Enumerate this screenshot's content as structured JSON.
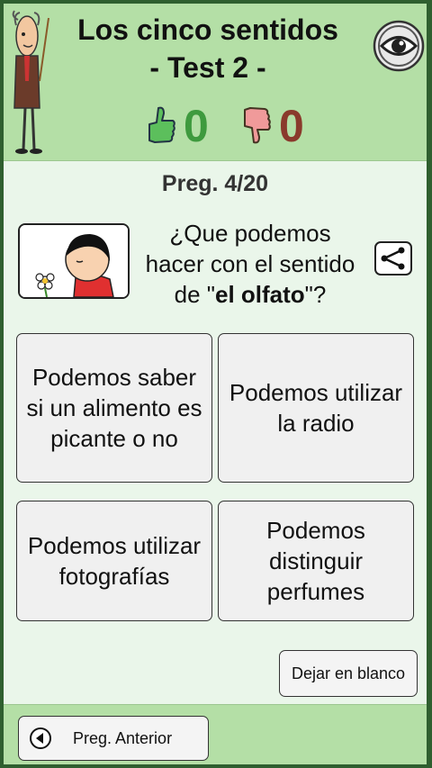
{
  "header": {
    "title_line1": "Los cinco sentidos",
    "title_line2": "- Test 2 -",
    "correct_count": "0",
    "wrong_count": "0",
    "correct_color": "#3e9a3e",
    "wrong_color": "#8a3a2c"
  },
  "question": {
    "counter": "Preg. 4/20",
    "line1": "¿Que podemos",
    "line2": "hacer con el sentido",
    "line3_pre": "de \"",
    "line3_bold": "el olfato",
    "line3_post": "\"?"
  },
  "answers": [
    "Podemos saber si un alimento es picante o no",
    "Podemos utilizar la radio",
    "Podemos utilizar fotografías",
    "Podemos distinguir perfumes"
  ],
  "actions": {
    "skip_label": "Dejar en blanco",
    "prev_label": "Preg. Anterior"
  },
  "icons": {
    "teacher": "teacher-with-pointer-icon",
    "eye": "eye-icon",
    "thumb_up": "thumbs-up-icon",
    "thumb_down": "thumbs-down-icon",
    "share": "share-icon",
    "back": "back-arrow-icon"
  }
}
